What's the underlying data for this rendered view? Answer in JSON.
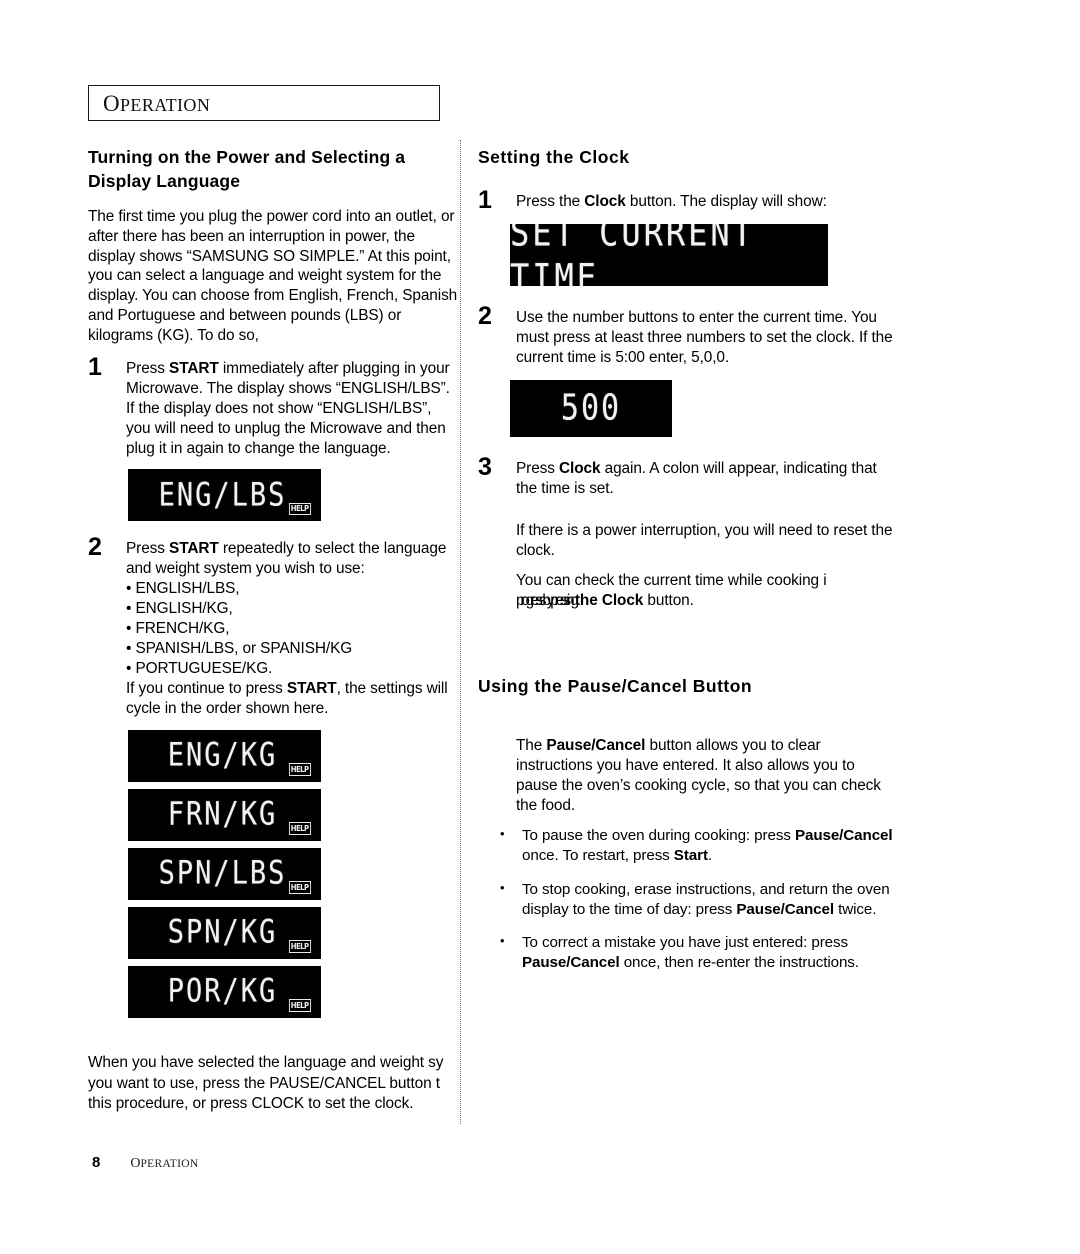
{
  "page": {
    "section_header": {
      "first_letter": "O",
      "rest": "PERATION"
    },
    "footer": {
      "page_number": "8",
      "label_first": "O",
      "label_rest": "PERATION"
    },
    "colors": {
      "lcd_background": "#000000",
      "lcd_text": "#f2f2f2",
      "ink": "#000000"
    }
  },
  "left_column": {
    "heading": "Turning on the Power and Selecting a Display Language",
    "intro": "The first time you plug the power cord into an outlet, or after there has been an interruption in power, the display shows “SAMSUNG SO SIMPLE.” At this point, you can select a language and weight system for the display. You can choose from English, French, Spanish and Portuguese and between pounds (LBS) or kilograms (KG). To do so,",
    "step1": {
      "number": "1",
      "text_a": "Press ",
      "bold_a": "START",
      "text_b": " immediately after plugging in your Microwave. The display shows “ENGLISH/LBS”. If the display does not show “ENGLISH/LBS”, you will need to unplug the Microwave and then plug it in again to change the language."
    },
    "display1": {
      "text": "ENG/LBS",
      "help_badge": "HELP"
    },
    "step2": {
      "number": "2",
      "text_a": "Press ",
      "bold_a": "START",
      "text_b": " repeatedly to select the language and weight system you wish to use:",
      "options": [
        "• ENGLISH/LBS,",
        "• ENGLISH/KG,",
        "• FRENCH/KG,",
        "• SPANISH/LBS, or  SPANISH/KG",
        "• PORTUGUESE/KG."
      ],
      "text_c": "If you continue to press ",
      "bold_b": "START",
      "text_d": ", the settings will cycle in the order shown here."
    },
    "display_stack": [
      {
        "text": "ENG/KG",
        "help_badge": "HELP"
      },
      {
        "text": "FRN/KG",
        "help_badge": "HELP"
      },
      {
        "text": "SPN/LBS",
        "help_badge": "HELP"
      },
      {
        "text": "SPN/KG",
        "help_badge": "HELP"
      },
      {
        "text": "POR/KG",
        "help_badge": "HELP"
      }
    ],
    "closing_lines": [
      "When you have selected the language and weight sy",
      "you want to use, press the PAUSE/CANCEL button t",
      "this procedure, or press CLOCK to set the clock."
    ]
  },
  "right_column": {
    "clock_heading": "Setting the Clock",
    "clock_step1": {
      "number": "1",
      "text_a": "Press the ",
      "bold_a": "Clock",
      "text_b": " button.  The display will show:"
    },
    "display_set_time": {
      "text": "SET CURRENT TIME"
    },
    "clock_step2": {
      "number": "2",
      "text": "Use the number buttons to enter the current time. You must press at least three numbers to set the clock. If the current time is 5:00 enter, 5,0,0."
    },
    "display_time": {
      "text": "500"
    },
    "clock_step3": {
      "number": "3",
      "text_a": "Press ",
      "bold_a": "Clock",
      "text_b": " again. A colon will appear, indicating that the time is set."
    },
    "note_power": "If there is a power interruption, you will need to reset the clock.",
    "note_check_line1": "You can check the current time while cooking i",
    "note_check_line2_a": "progress by pressing",
    "note_check_line2_bold": "the Clock",
    "note_check_line2_b": " button.",
    "pause_heading": "Using the Pause/Cancel Button",
    "pause_intro_a": "The ",
    "pause_intro_bold": "Pause/Cancel",
    "pause_intro_b": " button allows you to clear instructions you have entered.  It also allows you to pause the oven’s cooking cycle, so that you can check the food.",
    "bullets": [
      {
        "marker": "•",
        "text_a": "To pause the oven during cooking: press ",
        "bold_a": "Pause/Cancel",
        "text_b": " once. To restart, press ",
        "bold_b": "Start",
        "text_c": "."
      },
      {
        "marker": "•",
        "text_a": "To stop cooking, erase instructions, and return the oven display to the time of day: press ",
        "bold_a": "Pause/Cancel",
        "text_b": " twice.",
        "bold_b": "",
        "text_c": ""
      },
      {
        "marker": "•",
        "text_a": "To correct a mistake you have just entered: press ",
        "bold_a": "Pause/Cancel",
        "text_b": " once, then re-enter the instructions.",
        "bold_b": "",
        "text_c": ""
      }
    ]
  }
}
